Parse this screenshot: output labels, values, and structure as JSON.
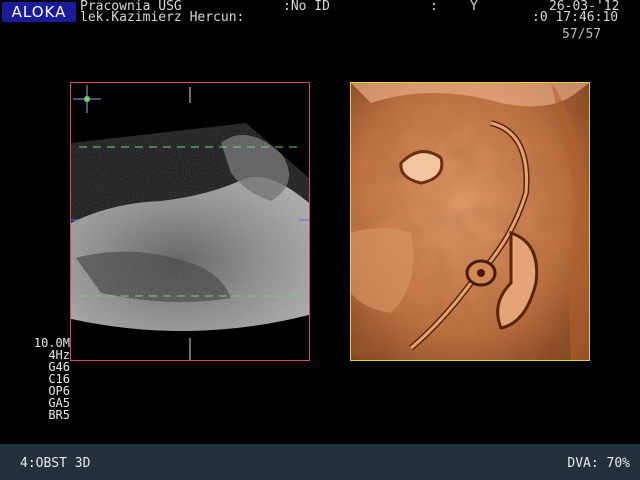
{
  "header": {
    "logo": "ALOKA",
    "institution": "Pracownia USG",
    "doctor": "lek.Kazimierz Hercun:",
    "patient_id": ":No ID",
    "colon": ":",
    "field_y": "Y",
    "date": "26-03-'12",
    "time": ":0 17:46:10",
    "frame_counter": "57/57"
  },
  "params": {
    "items": [
      "10.0M",
      "4Hz",
      "G46",
      "C16",
      "OP6",
      "GA5",
      "BR5"
    ]
  },
  "footer": {
    "mode": "4:OBST 3D",
    "dva": "DVA: 70%"
  }
}
